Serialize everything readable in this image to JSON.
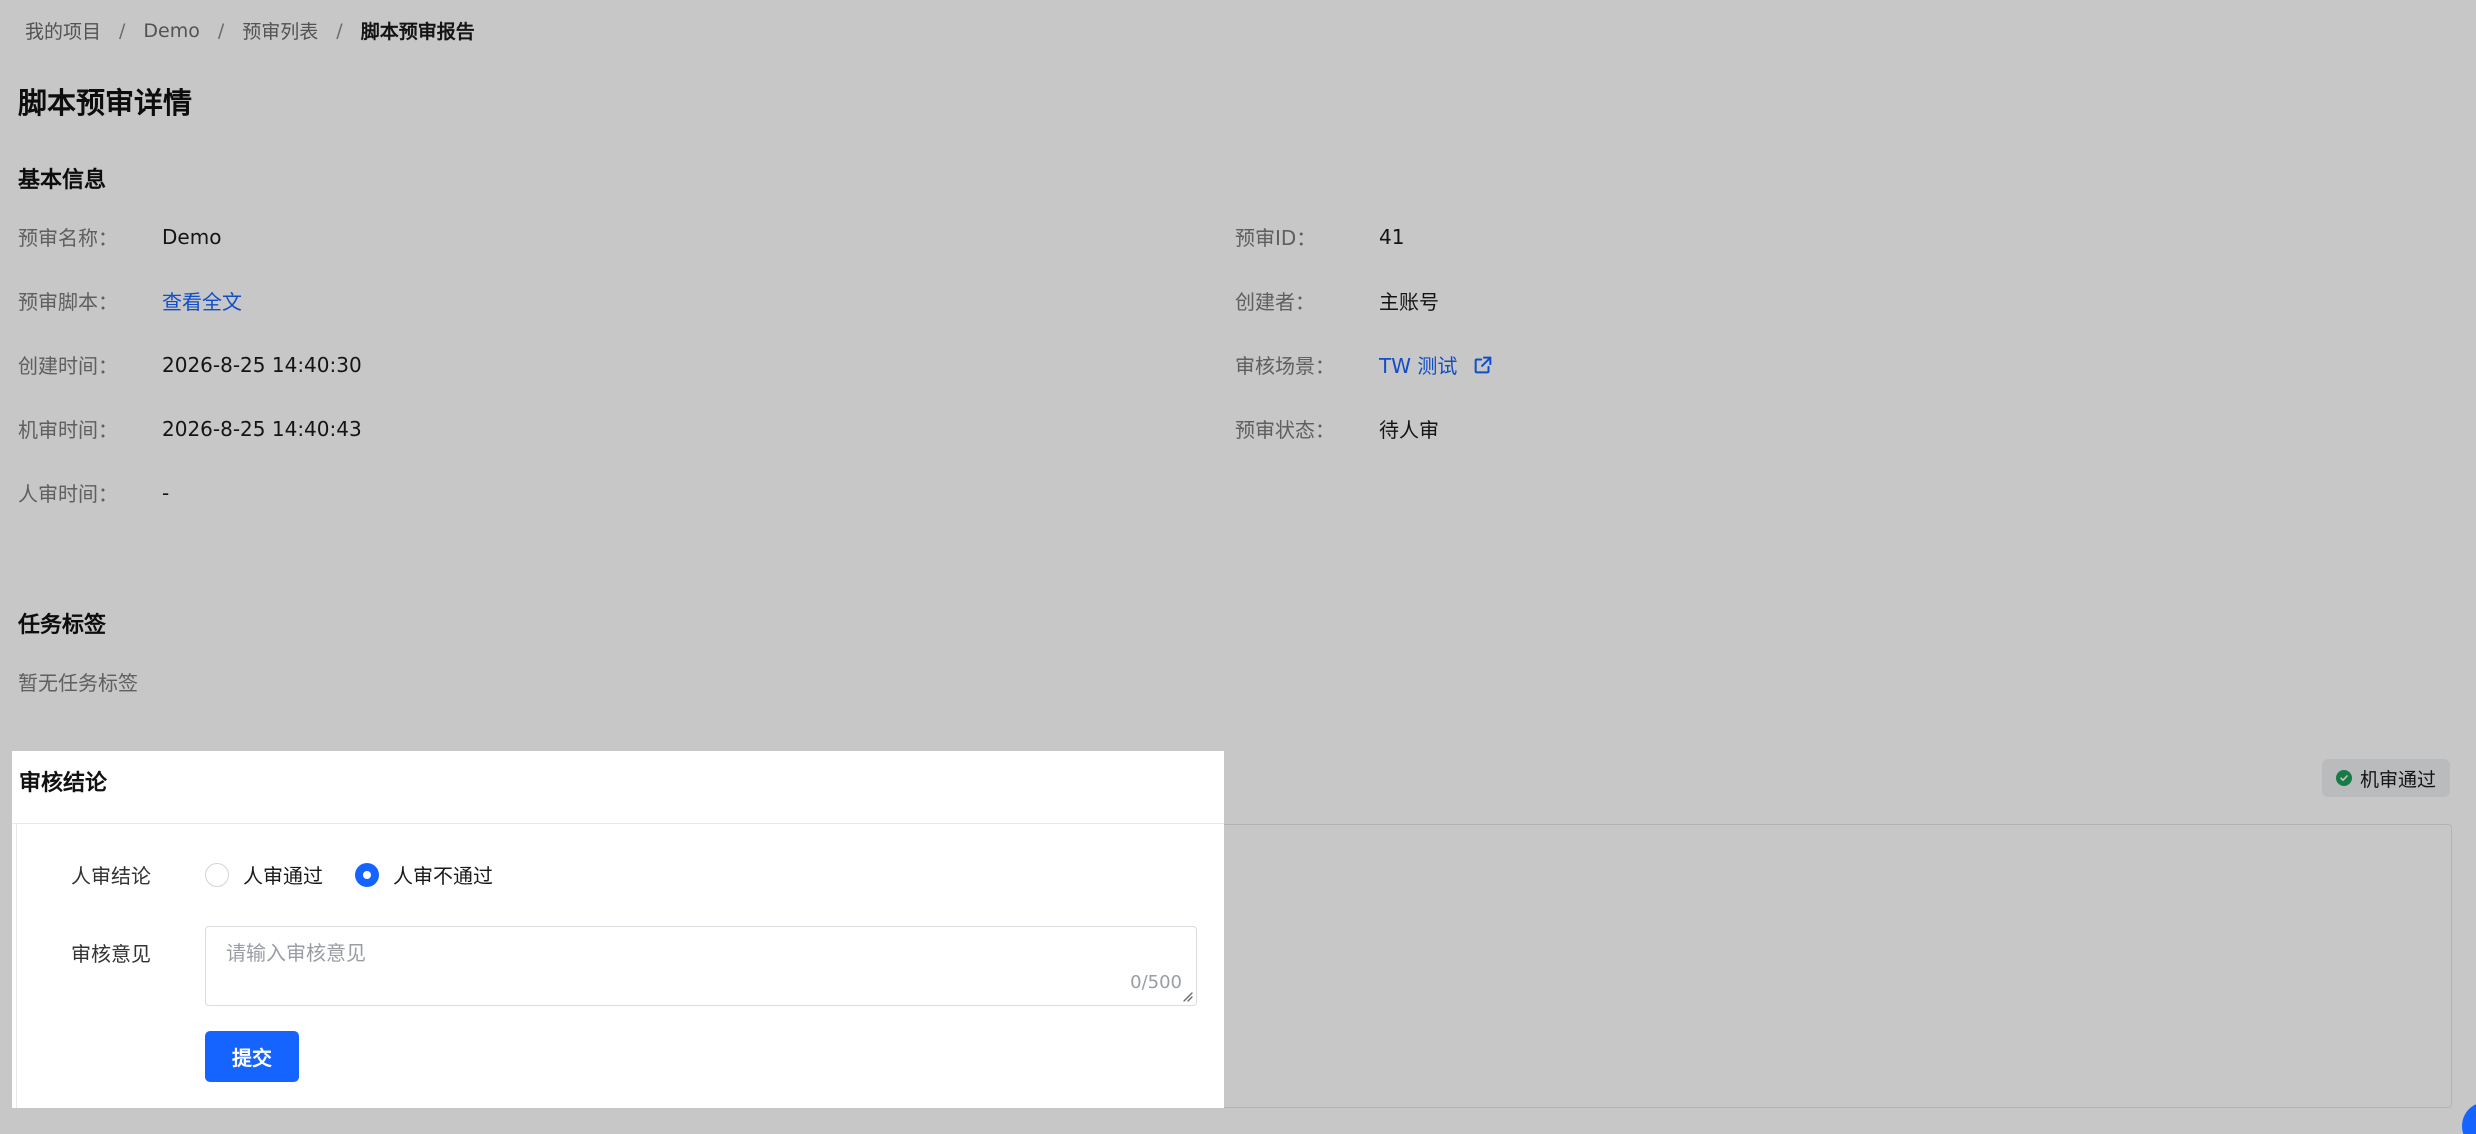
{
  "breadcrumb": {
    "items": [
      "我的项目",
      "Demo",
      "预审列表",
      "脚本预审报告"
    ],
    "separator": "/"
  },
  "page_title": "脚本预审详情",
  "basic_info": {
    "title": "基本信息",
    "left": [
      {
        "label": "预审名称：",
        "value": "Demo"
      },
      {
        "label": "预审脚本：",
        "value": "查看全文"
      },
      {
        "label": "创建时间：",
        "value": "2026-8-25 14:40:30"
      },
      {
        "label": "机审时间：",
        "value": "2026-8-25 14:40:43"
      },
      {
        "label": "人审时间：",
        "value": "-"
      }
    ],
    "right": [
      {
        "label": "预审ID：",
        "value": "41"
      },
      {
        "label": "创建者：",
        "value": "主账号"
      },
      {
        "label": "审核场景：",
        "value": "TW 测试"
      },
      {
        "label": "预审状态：",
        "value": "待人审"
      }
    ]
  },
  "task_tags": {
    "title": "任务标签",
    "empty_text": "暂无任务标签"
  },
  "conclusion": {
    "title": "审核结论",
    "machine_badge": "机审通过",
    "human_label": "人审结论",
    "options": [
      {
        "label": "人审通过",
        "checked": false
      },
      {
        "label": "人审不通过",
        "checked": true
      }
    ],
    "opinion_label": "审核意见",
    "opinion_placeholder": "请输入审核意见",
    "opinion_value": "",
    "counter": "0/500",
    "submit_label": "提交"
  },
  "colors": {
    "primary": "#1664ff",
    "success": "#1e9e5a",
    "mask": "rgba(0,0,0,0.22)"
  }
}
